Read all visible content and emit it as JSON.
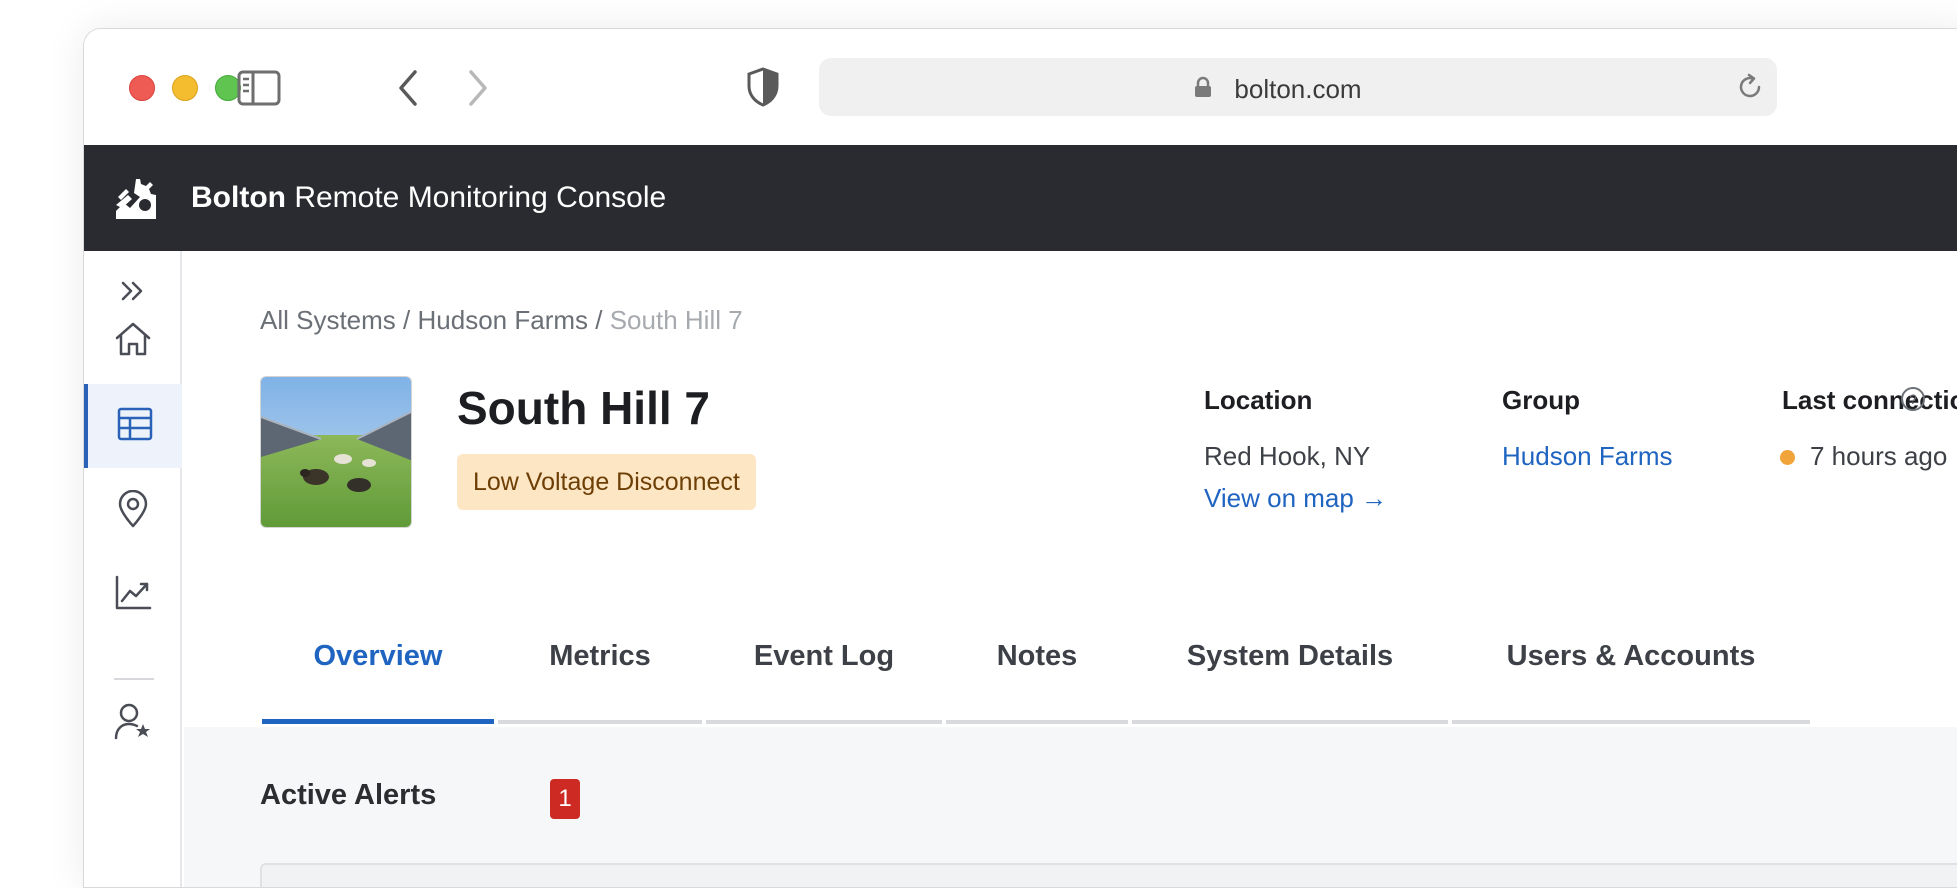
{
  "browser": {
    "url": "bolton.com"
  },
  "header": {
    "brand": "Bolton",
    "title": "Remote Monitoring Console"
  },
  "sidebar": {
    "items": [
      {
        "icon": "expand-icon"
      },
      {
        "icon": "home-icon"
      },
      {
        "icon": "table-icon",
        "active": true
      },
      {
        "icon": "location-pin-icon"
      },
      {
        "icon": "chart-icon"
      },
      {
        "icon": "user-star-icon"
      }
    ]
  },
  "breadcrumb": {
    "items": [
      "All Systems",
      "Hudson Farms"
    ],
    "separator": "/",
    "current": "South Hill 7"
  },
  "system": {
    "name": "South Hill 7",
    "status": "Low Voltage Disconnect"
  },
  "meta": {
    "location_label": "Location",
    "location_value": "Red Hook, NY",
    "map_link": "View on map →",
    "group_label": "Group",
    "group_value": "Hudson Farms",
    "last_label": "Last connection",
    "last_value": "7 hours ago"
  },
  "tabs": [
    "Overview",
    "Metrics",
    "Event Log",
    "Notes",
    "System Details",
    "Users & Accounts"
  ],
  "alerts": {
    "title": "Active Alerts",
    "count": "1"
  },
  "colors": {
    "accent": "#1f64c0",
    "header_bg": "#2a2b30",
    "status_bg": "#fde6c3",
    "alert_badge": "#cc2a22",
    "connection_dot": "#f0a43a"
  }
}
